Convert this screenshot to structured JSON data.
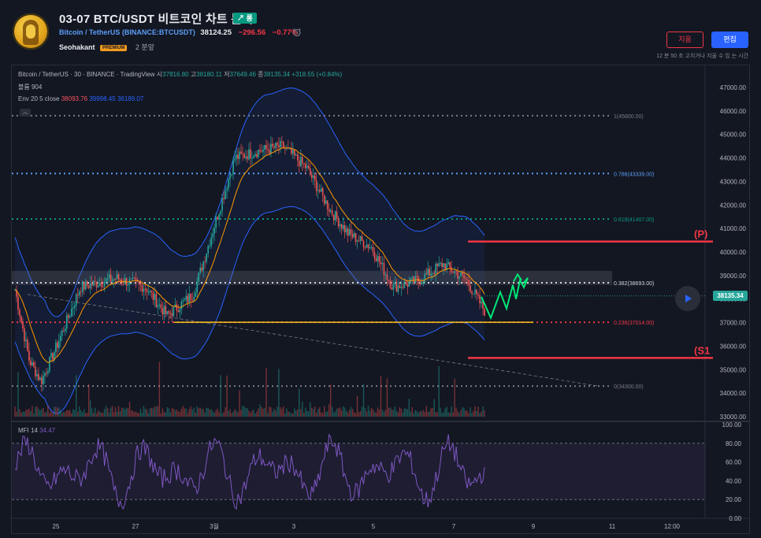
{
  "header": {
    "title": "03-07 BTC/USDT 비트코인 차트 분석",
    "direction_badge": "↗ 롱",
    "symbol_name": "Bitcoin / TetherUS",
    "symbol_code": "(BINANCE:BTCUSDT)",
    "last_price": "38124.25",
    "change": "−296.56",
    "change_pct": "−0.77%",
    "author": "Seohakant",
    "author_badge": "PREMIUM",
    "published_ago": "2 분앞",
    "delete_label": "지움",
    "edit_label": "편집",
    "edit_note": "12 분 50 초 고치거나 지울 수 있 는 시간"
  },
  "chart": {
    "legend": {
      "symbol": "Bitcoin / TetherUS · 30 · BINANCE · TradingView",
      "open_label": "시",
      "open": "37816.80",
      "high_label": "고",
      "high": "38180.11",
      "low_label": "저",
      "low": "37649.46",
      "close_label": "종",
      "close": "38135.34",
      "change": "+318.55 (+0.84%)",
      "volume_label": "볼륨",
      "volume": "904",
      "env_label": "Env 20 5 close",
      "env_upper": "38093.76",
      "env_basis": "39998.45",
      "env_lower": "36189.07"
    },
    "collapse_icon": "chevron-up-icon",
    "current_price_tag": "38135.34",
    "price_axis": [
      "47000.00",
      "46000.00",
      "45000.00",
      "44000.00",
      "43000.00",
      "42000.00",
      "41000.00",
      "40000.00",
      "39000.00",
      "38000.00",
      "37000.00",
      "36000.00",
      "35000.00",
      "34000.00",
      "33000.00"
    ],
    "mfi_axis": [
      "100.00",
      "80.00",
      "60.00",
      "40.00",
      "20.00",
      "0.00"
    ],
    "time_axis": [
      "25",
      "27",
      "3월",
      "3",
      "5",
      "7",
      "9",
      "11",
      "12:00"
    ],
    "fib_levels": [
      {
        "label": "1(45800.00)",
        "price": 45800,
        "color": "#787b86"
      },
      {
        "label": "0.786(43339.00)",
        "price": 43339,
        "color": "#5b9cf6"
      },
      {
        "label": "0.618(41407.00)",
        "price": 41407,
        "color": "#089981"
      },
      {
        "label": "0.382(38693.00)",
        "price": 38693,
        "color": "#d1d4dc"
      },
      {
        "label": "0.236(37014.00)",
        "price": 37014,
        "color": "#f23645"
      },
      {
        "label": "0(34300.00)",
        "price": 34300,
        "color": "#787b86"
      }
    ],
    "annotations": {
      "pivot_label": "(P)",
      "support_label": "(S1",
      "pivot_price": 40450,
      "support_price": 35500
    },
    "mfi_legend": {
      "label": "MFI 14",
      "value": "34.47"
    },
    "colors": {
      "up": "#26a69a",
      "down": "#ef5350",
      "envelope": "#2962ff",
      "ema": "#ff9800",
      "mfi": "#7e57c2",
      "projection": "#00e676",
      "level_red": "#f23645",
      "level_yellow": "#f7c31a"
    }
  }
}
